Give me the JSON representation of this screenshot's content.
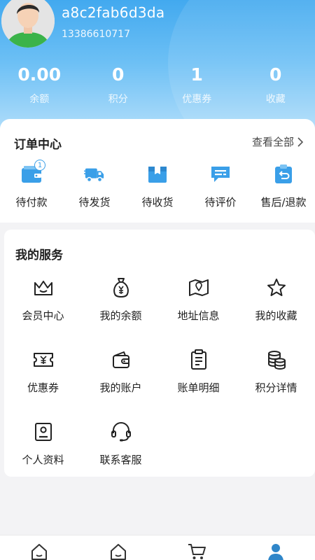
{
  "user": {
    "name": "a8c2fab6d3da",
    "phone": "13386610717"
  },
  "stats": [
    {
      "value": "0.00",
      "label": "余额"
    },
    {
      "value": "0",
      "label": "积分"
    },
    {
      "value": "1",
      "label": "优惠券"
    },
    {
      "value": "0",
      "label": "收藏"
    }
  ],
  "orders": {
    "title": "订单中心",
    "view_all": "查看全部",
    "items": [
      {
        "label": "待付款",
        "icon": "wallet-icon",
        "badge": "1"
      },
      {
        "label": "待发货",
        "icon": "truck-icon"
      },
      {
        "label": "待收货",
        "icon": "package-icon"
      },
      {
        "label": "待评价",
        "icon": "comment-icon"
      },
      {
        "label": "售后/退款",
        "icon": "refund-icon"
      }
    ]
  },
  "services": {
    "title": "我的服务",
    "items": [
      {
        "label": "会员中心",
        "icon": "crown-icon"
      },
      {
        "label": "我的余额",
        "icon": "money-bag-icon"
      },
      {
        "label": "地址信息",
        "icon": "map-icon"
      },
      {
        "label": "我的收藏",
        "icon": "star-icon"
      },
      {
        "label": "优惠券",
        "icon": "coupon-icon"
      },
      {
        "label": "我的账户",
        "icon": "account-wallet-icon"
      },
      {
        "label": "账单明细",
        "icon": "bill-icon"
      },
      {
        "label": "积分详情",
        "icon": "coins-icon"
      },
      {
        "label": "个人资料",
        "icon": "profile-icon"
      },
      {
        "label": "联系客服",
        "icon": "headset-icon"
      }
    ]
  },
  "tabbar": [
    {
      "icon": "home-icon"
    },
    {
      "icon": "category-icon"
    },
    {
      "icon": "cart-icon"
    },
    {
      "icon": "user-icon",
      "active": true
    }
  ],
  "colors": {
    "accent": "#3a9fe8",
    "header_top": "#42a9ef",
    "header_bottom": "#b9e1fb"
  }
}
